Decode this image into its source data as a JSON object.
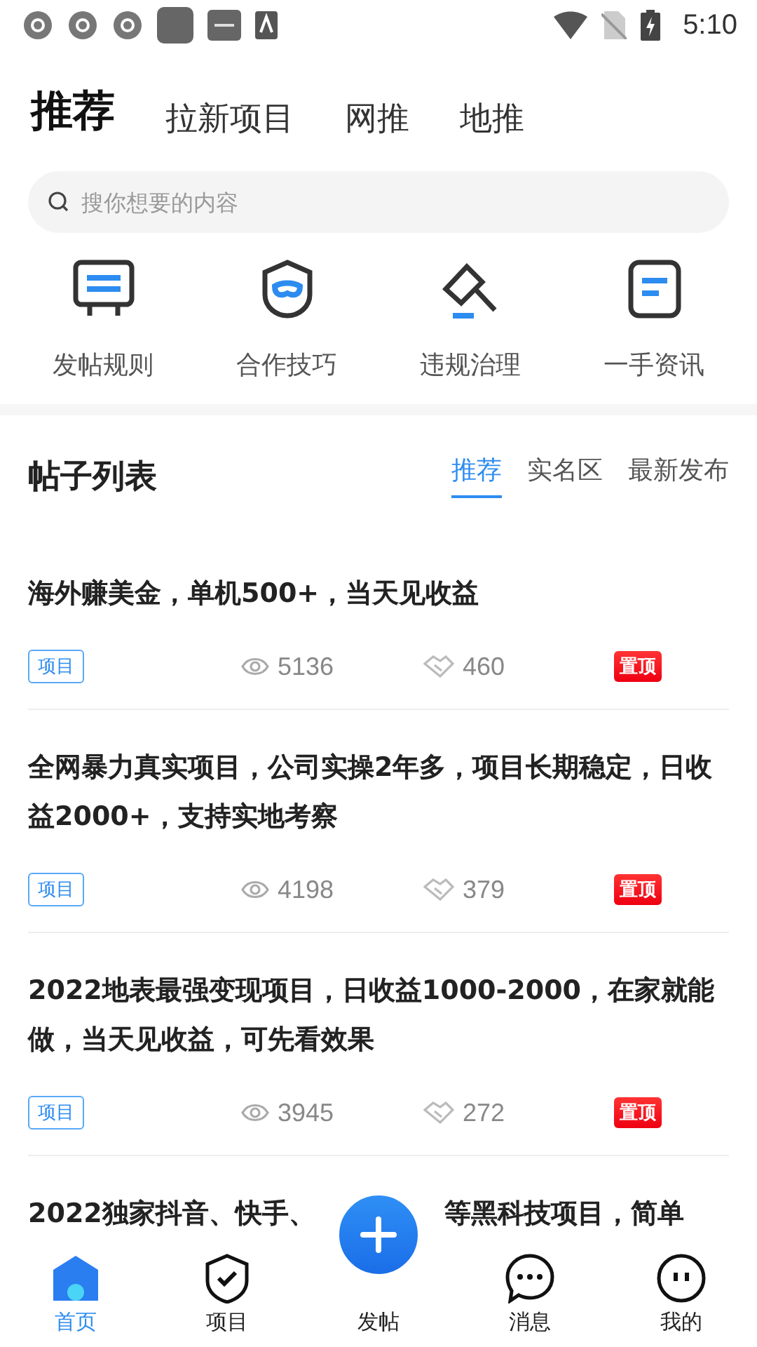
{
  "status_bar": {
    "time": "5:10"
  },
  "top_tabs": [
    {
      "label": "推荐",
      "selected": true
    },
    {
      "label": "拉新项目",
      "selected": false
    },
    {
      "label": "网推",
      "selected": false
    },
    {
      "label": "地推",
      "selected": false
    }
  ],
  "search": {
    "placeholder": "搜你想要的内容"
  },
  "shortcuts": [
    {
      "label": "发帖规则",
      "kind": "board"
    },
    {
      "label": "合作技巧",
      "kind": "shield"
    },
    {
      "label": "违规治理",
      "kind": "gavel"
    },
    {
      "label": "一手资讯",
      "kind": "note"
    }
  ],
  "post_list": {
    "title": "帖子列表",
    "tabs": [
      {
        "label": "推荐",
        "selected": true
      },
      {
        "label": "实名区",
        "selected": false
      },
      {
        "label": "最新发布",
        "selected": false
      }
    ],
    "posts": [
      {
        "title": "海外赚美金，单机500+，当天见收益",
        "tag": "项目",
        "views": "5136",
        "likes": "460",
        "badge": "置顶"
      },
      {
        "title": "全网暴力真实项目，公司实操2年多，项目长期稳定，日收益2000+，支持实地考察",
        "tag": "项目",
        "views": "4198",
        "likes": "379",
        "badge": "置顶"
      },
      {
        "title": "2022地表最强变现项目，日收益1000-2000，在家就能做，当天见收益，可先看效果",
        "tag": "项目",
        "views": "3945",
        "likes": "272",
        "badge": "置顶"
      },
      {
        "title_parts": [
          "2022独家抖音、快手、",
          "等黑科技项目，简单"
        ]
      }
    ]
  },
  "bottom_nav": [
    {
      "label": "首页",
      "kind": "home",
      "selected": true
    },
    {
      "label": "项目",
      "kind": "shield",
      "selected": false
    },
    {
      "label": "发帖",
      "kind": "post",
      "selected": false
    },
    {
      "label": "消息",
      "kind": "chat",
      "selected": false
    },
    {
      "label": "我的",
      "kind": "face",
      "selected": false
    }
  ]
}
